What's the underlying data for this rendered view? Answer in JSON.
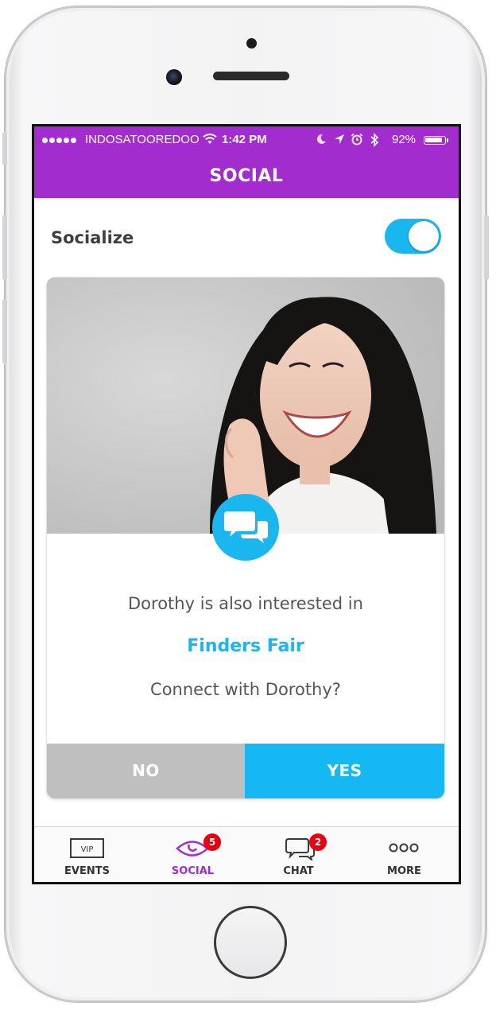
{
  "status_bar": {
    "carrier": "INDOSATOOREDOO",
    "time": "1:42 PM",
    "battery_percent": "92%",
    "battery_level": 0.92,
    "icons": [
      "signal-dots-icon",
      "wifi-icon",
      "moon-icon",
      "location-arrow-icon",
      "alarm-clock-icon",
      "bluetooth-icon",
      "battery-icon"
    ]
  },
  "header": {
    "title": "SOCIAL"
  },
  "socialize": {
    "label": "Socialize",
    "enabled": true
  },
  "card": {
    "photo": "profile-photo",
    "badge_icon": "chat-bubbles-icon",
    "line1": "Dorothy is also interested in",
    "event_name": "Finders Fair",
    "question": "Connect with Dorothy?",
    "no_label": "NO",
    "yes_label": "YES"
  },
  "tab_bar": {
    "tabs": [
      {
        "label": "EVENTS",
        "icon": "vip-ticket-icon",
        "icon_text": "VIP",
        "active": false
      },
      {
        "label": "SOCIAL",
        "icon": "eye-icon",
        "badge": "5",
        "active": true
      },
      {
        "label": "CHAT",
        "icon": "chat-bubbles-icon",
        "badge": "2",
        "active": false
      },
      {
        "label": "MORE",
        "icon": "more-dots-icon",
        "active": false
      }
    ]
  },
  "colors": {
    "brand_purple": "#a32ccf",
    "accent_blue": "#1ab6f0",
    "badge_red": "#e8000f",
    "no_gray": "#bfbfbf"
  }
}
